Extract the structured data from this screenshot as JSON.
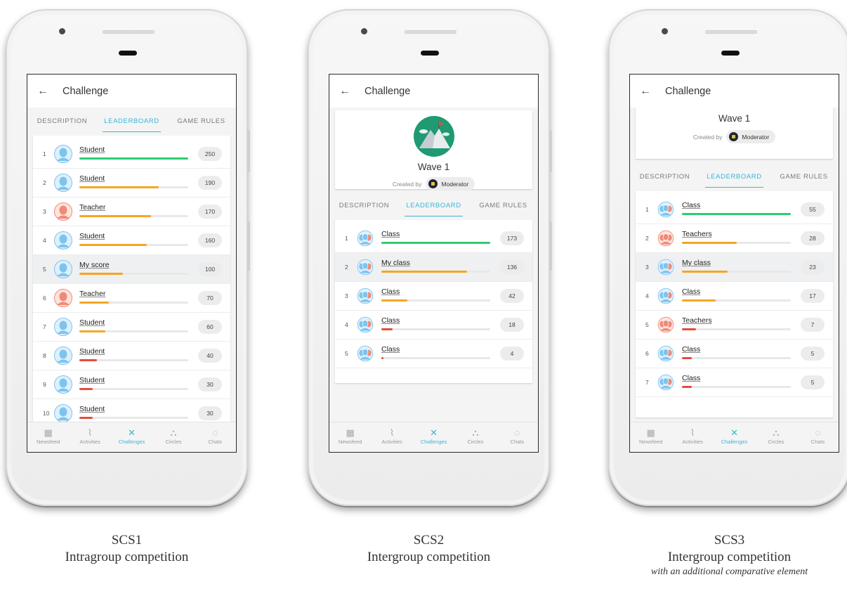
{
  "colors": {
    "accent": "#3ab5d6",
    "bar_green": "#2ecc71",
    "bar_orange": "#f5a623",
    "bar_red": "#e74c3c",
    "avatar_blue": "#7cc4f0",
    "avatar_red": "#f08a78"
  },
  "common": {
    "back_icon": "arrow-left-icon",
    "title": "Challenge",
    "tabs": [
      "DESCRIPTION",
      "LEADERBOARD",
      "GAME RULES"
    ],
    "nav": [
      {
        "label": "Newsfeed",
        "icon": "newsfeed-icon"
      },
      {
        "label": "Activities",
        "icon": "activities-icon"
      },
      {
        "label": "Challenges",
        "icon": "challenges-icon"
      },
      {
        "label": "Circles",
        "icon": "circles-icon"
      },
      {
        "label": "Chats",
        "icon": "chats-icon"
      }
    ],
    "wave_title": "Wave 1",
    "created_by": "Created by",
    "moderator": "Moderator"
  },
  "phones": [
    {
      "caption1": "SCS1",
      "caption2": "Intragroup competition",
      "caption3": "",
      "rows": [
        {
          "rank": "1",
          "name": "Student",
          "score": "250",
          "value": 1.0,
          "color": "green",
          "avatar": "blue",
          "group": false
        },
        {
          "rank": "2",
          "name": "Student",
          "score": "190",
          "value": 0.73,
          "color": "orange",
          "avatar": "blue",
          "group": false
        },
        {
          "rank": "3",
          "name": "Teacher",
          "score": "170",
          "value": 0.66,
          "color": "orange",
          "avatar": "red",
          "group": false
        },
        {
          "rank": "4",
          "name": "Student",
          "score": "160",
          "value": 0.62,
          "color": "orange",
          "avatar": "blue",
          "group": false
        },
        {
          "rank": "5",
          "name": "My score",
          "score": "100",
          "value": 0.4,
          "color": "orange",
          "avatar": "blue",
          "group": false,
          "highlight": true
        },
        {
          "rank": "6",
          "name": "Teacher",
          "score": "70",
          "value": 0.27,
          "color": "orange",
          "avatar": "red",
          "group": false
        },
        {
          "rank": "7",
          "name": "Student",
          "score": "60",
          "value": 0.24,
          "color": "orange",
          "avatar": "blue",
          "group": false
        },
        {
          "rank": "8",
          "name": "Student",
          "score": "40",
          "value": 0.16,
          "color": "red",
          "avatar": "blue",
          "group": false
        },
        {
          "rank": "9",
          "name": "Student",
          "score": "30",
          "value": 0.12,
          "color": "red",
          "avatar": "blue",
          "group": false
        },
        {
          "rank": "10",
          "name": "Student",
          "score": "30",
          "value": 0.12,
          "color": "red",
          "avatar": "blue",
          "group": false
        }
      ]
    },
    {
      "caption1": "SCS2",
      "caption2": "Intergroup competition",
      "caption3": "",
      "rows": [
        {
          "rank": "1",
          "name": "Class",
          "score": "173",
          "value": 1.0,
          "color": "green",
          "avatar": "blue",
          "group": true
        },
        {
          "rank": "2",
          "name": "My class",
          "score": "136",
          "value": 0.79,
          "color": "orange",
          "avatar": "blue",
          "group": true,
          "highlight": true
        },
        {
          "rank": "3",
          "name": "Class",
          "score": "42",
          "value": 0.24,
          "color": "orange",
          "avatar": "blue",
          "group": true
        },
        {
          "rank": "4",
          "name": "Class",
          "score": "18",
          "value": 0.1,
          "color": "red",
          "avatar": "blue",
          "group": true
        },
        {
          "rank": "5",
          "name": "Class",
          "score": "4",
          "value": 0.02,
          "color": "red",
          "avatar": "blue",
          "group": true
        }
      ]
    },
    {
      "caption1": "SCS3",
      "caption2": "Intergroup competition",
      "caption3": "with an additional comparative element",
      "rows": [
        {
          "rank": "1",
          "name": "Class",
          "score": "55",
          "value": 1.0,
          "color": "green",
          "avatar": "blue",
          "group": true
        },
        {
          "rank": "2",
          "name": "Teachers",
          "score": "28",
          "value": 0.5,
          "color": "orange",
          "avatar": "red",
          "group": true
        },
        {
          "rank": "3",
          "name": "My class",
          "score": "23",
          "value": 0.42,
          "color": "orange",
          "avatar": "blue",
          "group": true,
          "highlight": true
        },
        {
          "rank": "4",
          "name": "Class",
          "score": "17",
          "value": 0.31,
          "color": "orange",
          "avatar": "blue",
          "group": true
        },
        {
          "rank": "5",
          "name": "Teachers",
          "score": "7",
          "value": 0.13,
          "color": "red",
          "avatar": "red",
          "group": true
        },
        {
          "rank": "6",
          "name": "Class",
          "score": "5",
          "value": 0.09,
          "color": "red",
          "avatar": "blue",
          "group": true
        },
        {
          "rank": "7",
          "name": "Class",
          "score": "5",
          "value": 0.09,
          "color": "red",
          "avatar": "blue",
          "group": true
        }
      ]
    }
  ]
}
